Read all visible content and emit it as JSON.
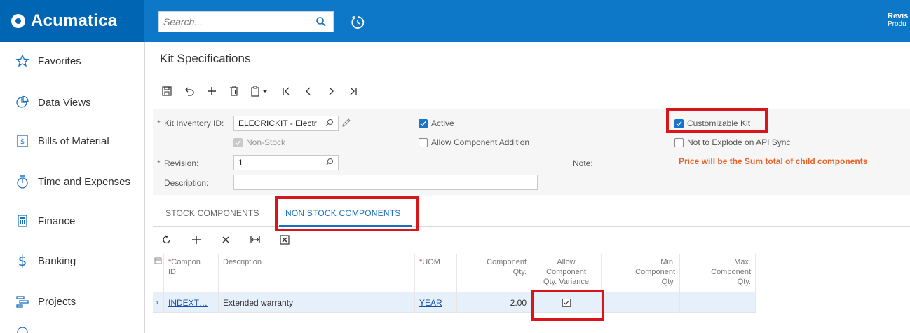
{
  "app": {
    "brand": "Acumatica"
  },
  "topbar": {
    "search_placeholder": "Search...",
    "right_title": "Revis",
    "right_sub": "Produ"
  },
  "sidebar": {
    "items": [
      {
        "label": "Favorites",
        "icon": "star-icon"
      },
      {
        "label": "Data Views",
        "icon": "pie-chart-icon"
      },
      {
        "label": "Bills of Material",
        "icon": "document-dollar-icon"
      },
      {
        "label": "Time and Expenses",
        "icon": "stopwatch-icon"
      },
      {
        "label": "Finance",
        "icon": "calculator-icon"
      },
      {
        "label": "Banking",
        "icon": "dollar-icon"
      },
      {
        "label": "Projects",
        "icon": "projects-icon"
      }
    ]
  },
  "page": {
    "title": "Kit Specifications"
  },
  "form": {
    "kit_id_label": "Kit Inventory ID:",
    "kit_id_value": "ELECRICKIT - Electr",
    "non_stock_label": "Non-Stock",
    "revision_label": "Revision:",
    "revision_value": "1",
    "description_label": "Description:",
    "description_value": "",
    "active_label": "Active",
    "allow_addition_label": "Allow Component Addition",
    "note_label": "Note:",
    "customizable_label": "Customizable Kit",
    "not_explode_label": "Not to Explode on API Sync",
    "price_note": "Price will be the Sum total of child components"
  },
  "tabs": [
    {
      "label": "STOCK COMPONENTS"
    },
    {
      "label": "NON STOCK COMPONENTS"
    }
  ],
  "grid": {
    "headers": {
      "component_id_1": "Compon",
      "component_id_2": "ID",
      "description": "Description",
      "uom": "UOM",
      "qty_1": "Component",
      "qty_2": "Qty.",
      "allow_1": "Allow",
      "allow_2": "Component",
      "allow_3": "Qty. Variance",
      "min_1": "Min.",
      "min_2": "Component",
      "min_3": "Qty.",
      "max_1": "Max.",
      "max_2": "Component",
      "max_3": "Qty."
    },
    "rows": [
      {
        "component_id": "INDEXT…",
        "description": "Extended warranty",
        "uom": "YEAR",
        "qty": "2.00",
        "allow_variance": true
      }
    ]
  },
  "colors": {
    "topbar": "#0d78c8",
    "logo_bg": "#0065b3",
    "highlight": "#d9141b",
    "accent": "#1a6fc0",
    "note": "#e8632b"
  }
}
